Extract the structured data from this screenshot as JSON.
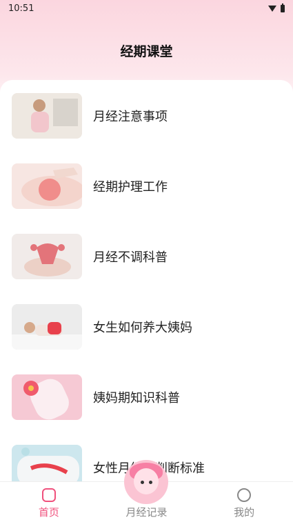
{
  "status": {
    "time": "10:51"
  },
  "page": {
    "title": "经期课堂"
  },
  "items": [
    {
      "label": "月经注意事项",
      "image": "woman-in-bed-photo"
    },
    {
      "label": "经期护理工作",
      "image": "abdomen-pain-photo"
    },
    {
      "label": "月经不调科普",
      "image": "uterus-illustration-photo"
    },
    {
      "label": "女生如何养大姨妈",
      "image": "hot-water-bag-photo"
    },
    {
      "label": "姨妈期知识科普",
      "image": "sanitary-pad-flower-photo"
    },
    {
      "label": "女性月经量判断标准",
      "image": "pad-feather-photo"
    }
  ],
  "tabs": [
    {
      "label": "首页",
      "icon": "home-icon",
      "active": true
    },
    {
      "label": "月经记录",
      "icon": "mascot-icon",
      "active": false
    },
    {
      "label": "我的",
      "icon": "chat-bubble-icon",
      "active": false
    }
  ],
  "colors": {
    "accent": "#f0507c",
    "header_pink": "#fbd6df"
  }
}
